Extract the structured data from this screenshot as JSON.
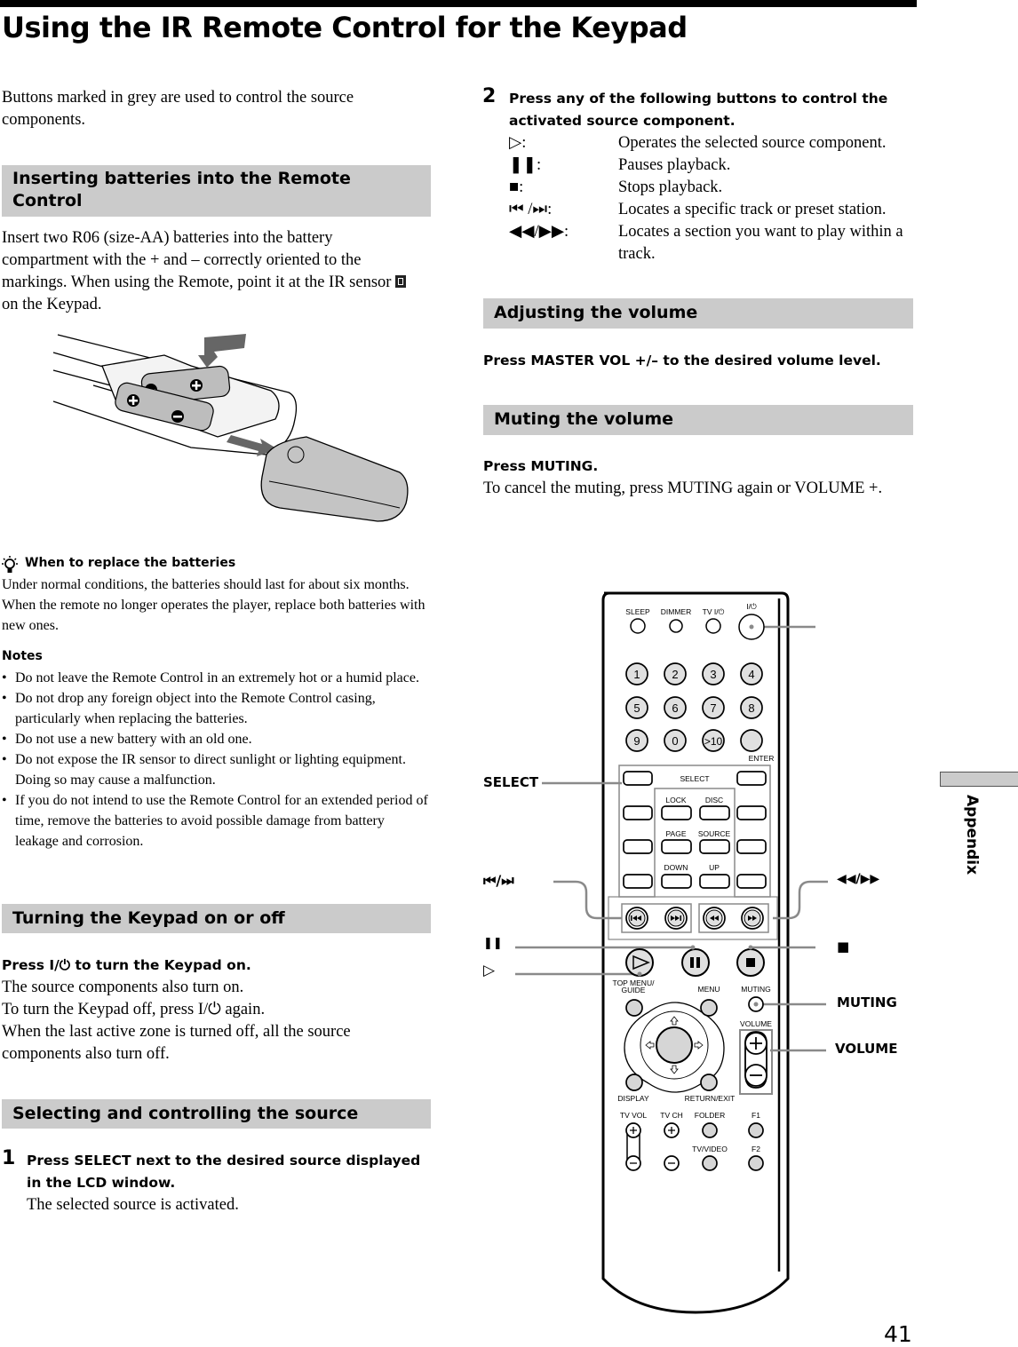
{
  "page": {
    "title": "Using the IR Remote Control for the Keypad",
    "page_number": "41",
    "side_tab": "Appendix"
  },
  "left": {
    "intro": "Buttons marked in grey are used to control the source components.",
    "batteries": {
      "heading": "Inserting batteries into the Remote Control",
      "body_before_icon": "Insert two R06 (size-AA) batteries into the battery compartment with the + and – correctly oriented to the markings. When using the Remote, point it at the IR sensor",
      "body_after_icon": "on the Keypad.",
      "illustration_icon": "battery-insertion-illustration"
    },
    "tip": {
      "icon": "lightbulb-tip-icon",
      "title": "When to replace the batteries",
      "body": "Under normal conditions, the batteries should last for about six months.  When the remote no longer operates the player, replace both batteries with new ones."
    },
    "notes": {
      "title": "Notes",
      "items": [
        "Do not leave the Remote Control in an extremely hot or a humid place.",
        "Do not drop any foreign object into the Remote Control casing, particularly when replacing the batteries.",
        "Do not use a new battery with an old one.",
        "Do not expose the IR sensor to direct sunlight or lighting equipment. Doing so may cause a malfunction.",
        "If you do not intend to use the Remote Control for an extended period of time, remove the batteries to avoid possible damage from battery leakage and corrosion."
      ]
    },
    "power": {
      "heading": "Turning the Keypad on or off",
      "instruction": "Press I/⏻ to turn the Keypad on.",
      "lines": [
        "The source components also turn on.",
        "To turn the Keypad off, press I/⏻ again.",
        "When the last active zone is turned off, all the source components also turn off."
      ]
    },
    "source": {
      "heading": "Selecting and controlling the source",
      "step1_num": "1",
      "step1_instruction": "Press SELECT next to the desired source displayed in the LCD window.",
      "step1_result": "The selected source is activated."
    }
  },
  "right": {
    "step2_num": "2",
    "step2_instruction": "Press any of the following buttons to control the activated source component.",
    "symbols": [
      {
        "symbol": "▷:",
        "desc": "Operates the selected source component."
      },
      {
        "symbol": "❚❚:",
        "desc": "Pauses playback."
      },
      {
        "symbol": "■:",
        "desc": "Stops playback."
      },
      {
        "symbol": "⏮ /⏭:",
        "desc": "Locates a specific track or preset station."
      },
      {
        "symbol": "◀◀/▶▶:",
        "desc": "Locates a section you want to play within a track."
      }
    ],
    "volume": {
      "heading": "Adjusting the volume",
      "instruction": "Press MASTER VOL +/– to the desired volume level."
    },
    "muting": {
      "heading": "Muting the volume",
      "instruction": "Press MUTING.",
      "body": "To cancel the muting, press MUTING again or VOLUME +."
    }
  },
  "remote": {
    "callouts": {
      "select": "SELECT",
      "prev_next": "⏮/⏭",
      "pause": "❚❚",
      "play": "▷",
      "rew_ff": "◀◀/▶▶",
      "stop": "■",
      "muting": "MUTING",
      "volume": "VOLUME"
    },
    "labels": {
      "sleep": "SLEEP",
      "dimmer": "DIMMER",
      "tv_power": "TV I/⏻",
      "power": "I/⏻",
      "enter": "ENTER",
      "select": "SELECT",
      "lock": "LOCK",
      "disc": "DISC",
      "page": "PAGE",
      "source": "SOURCE",
      "down": "DOWN",
      "up": "UP",
      "top_menu_1": "TOP MENU/",
      "top_menu_2": "GUIDE",
      "menu": "MENU",
      "muting": "MUTING",
      "volume": "VOLUME",
      "display": "DISPLAY",
      "return": "RETURN/EXIT",
      "tv_vol": "TV VOL",
      "tv_ch": "TV CH",
      "folder": "FOLDER",
      "f1": "F1",
      "tv_video": "TV/VIDEO",
      "f2": "F2"
    },
    "digits": [
      "1",
      "2",
      "3",
      "4",
      "5",
      "6",
      "7",
      "8",
      "9",
      "0",
      ">10"
    ]
  }
}
